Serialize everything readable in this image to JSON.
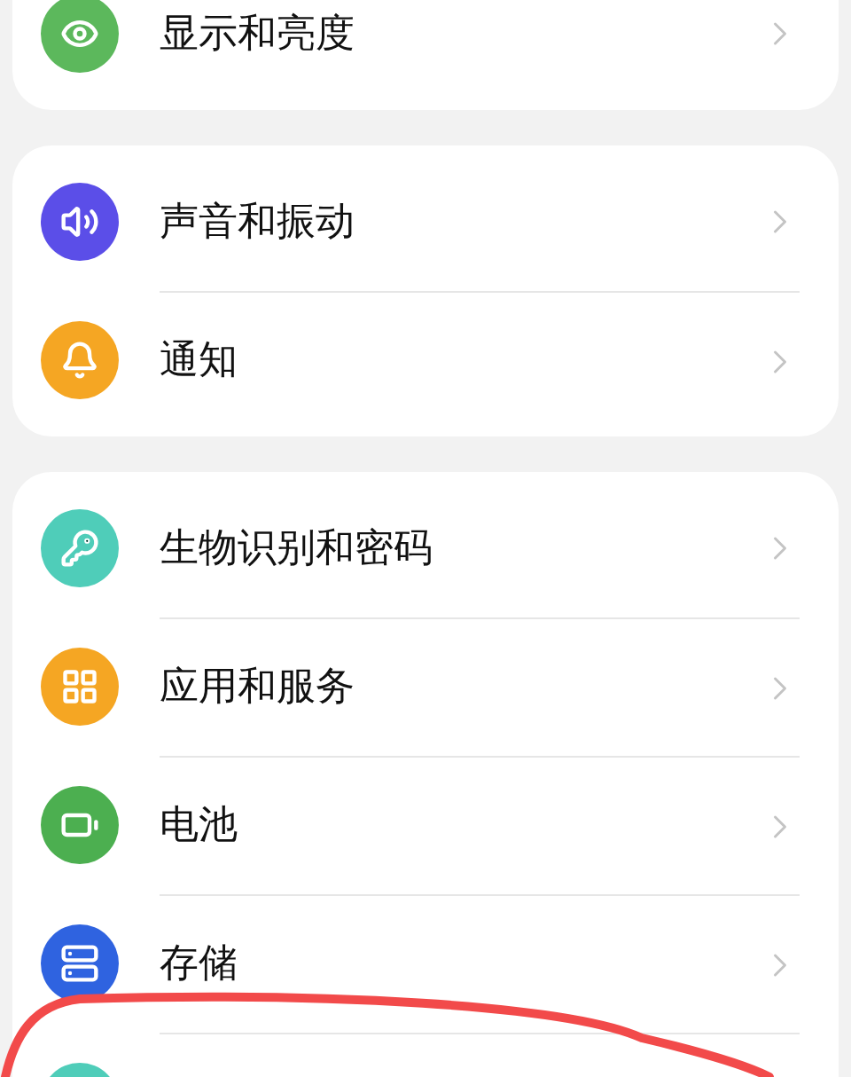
{
  "groups": [
    {
      "items": [
        {
          "kind": "display",
          "label": "显示和亮度",
          "color": "#5cb85c"
        }
      ]
    },
    {
      "items": [
        {
          "kind": "sound",
          "label": "声音和振动",
          "color": "#5b4ee8"
        },
        {
          "kind": "notification",
          "label": "通知",
          "color": "#f5a623"
        }
      ]
    },
    {
      "items": [
        {
          "kind": "security",
          "label": "生物识别和密码",
          "color": "#4fcdb9"
        },
        {
          "kind": "apps",
          "label": "应用和服务",
          "color": "#f5a623"
        },
        {
          "kind": "battery",
          "label": "电池",
          "color": "#4caf50"
        },
        {
          "kind": "storage",
          "label": "存储",
          "color": "#2f63e0"
        },
        {
          "kind": "other",
          "color": "#4fcdb9"
        }
      ]
    }
  ]
}
